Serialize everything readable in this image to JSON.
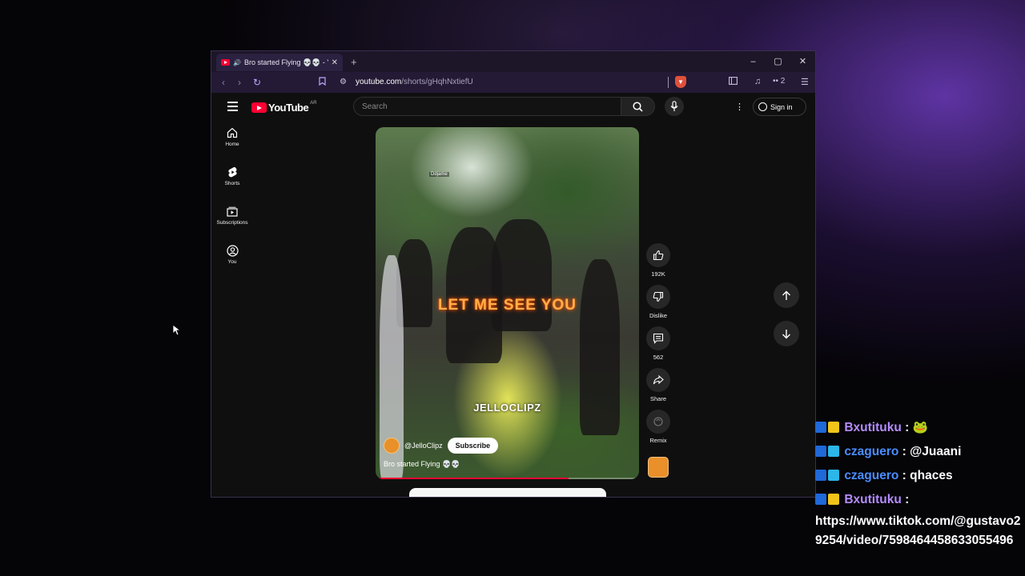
{
  "browser": {
    "tab_title": "Bro started Flying 💀💀 - You",
    "tab_close": "✕",
    "new_tab": "+",
    "url_host": "youtube.com",
    "url_path": "/shorts/gHqhNxtiefU",
    "extension_count": "2",
    "window_controls": {
      "minimize": "–",
      "maximize": "▢",
      "close": "✕"
    }
  },
  "youtube": {
    "logo_text": "YouTube",
    "logo_region": "AR",
    "search_placeholder": "Search",
    "sign_in": "Sign in",
    "sidebar": [
      {
        "label": "Home",
        "icon": "home-icon"
      },
      {
        "label": "Shorts",
        "icon": "shorts-icon"
      },
      {
        "label": "Subscriptions",
        "icon": "subscriptions-icon"
      },
      {
        "label": "You",
        "icon": "user-icon"
      }
    ],
    "short": {
      "caption": "LET ME SEE YOU",
      "watermark": "JELLOCLIPZ",
      "small_watermark": "Ddjame",
      "channel_handle": "@JelloClipz",
      "subscribe_label": "Subscribe",
      "title": "Bro started Flying 💀💀",
      "progress": 0.74
    },
    "actions": {
      "like_count": "192K",
      "dislike_label": "Dislike",
      "comment_count": "562",
      "share_label": "Share",
      "remix_label": "Remix"
    }
  },
  "chat": [
    {
      "user": "Bxutituku",
      "sep": " : ",
      "text": "🐸",
      "color": "#b58cff"
    },
    {
      "user": "czaguero",
      "sep": " : ",
      "text": "@Juaani",
      "color": "#4a8dff"
    },
    {
      "user": "czaguero",
      "sep": " : ",
      "text": "qhaces",
      "color": "#4a8dff"
    },
    {
      "user": "Bxutituku",
      "sep": " :",
      "text": "https://www.tiktok.com/@gustavo29254/video/7598464458633055496",
      "color": "#b58cff"
    }
  ]
}
